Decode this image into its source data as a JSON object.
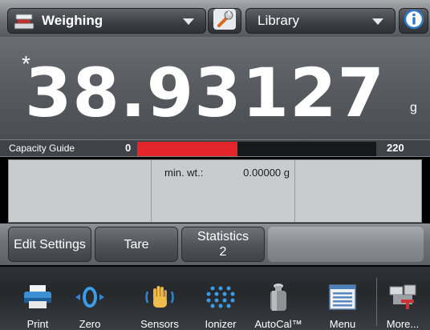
{
  "topbar": {
    "app_name": "Weighing",
    "app_icon": "balance-icon",
    "settings_icon": "wrench-icon",
    "library_label": "Library",
    "info_icon": "info-icon"
  },
  "display": {
    "stable_mark": "*",
    "weight": "38.93127",
    "unit": "g"
  },
  "capacity_guide": {
    "label": "Capacity Guide",
    "min": "0",
    "max": "220",
    "fill_fraction": 0.42,
    "fill_color": "#e3262a"
  },
  "info_panel": {
    "min_wt_label": "min. wt.:",
    "min_wt_value": "0.00000 g"
  },
  "softkeys": {
    "edit_settings": "Edit Settings",
    "tare": "Tare",
    "statistics_line1": "Statistics",
    "statistics_line2": "2"
  },
  "bottom_nav": {
    "items": [
      {
        "label": "Print",
        "icon": "printer-icon"
      },
      {
        "label": "Zero",
        "icon": "zero-icon"
      },
      {
        "label": "Sensors",
        "icon": "hand-sensor-icon"
      },
      {
        "label": "Ionizer",
        "icon": "ionizer-icon"
      },
      {
        "label": "AutoCal™",
        "icon": "autocal-weight-icon"
      },
      {
        "label": "Menu",
        "icon": "menu-icon"
      },
      {
        "label": "More...",
        "icon": "more-icon"
      }
    ]
  }
}
